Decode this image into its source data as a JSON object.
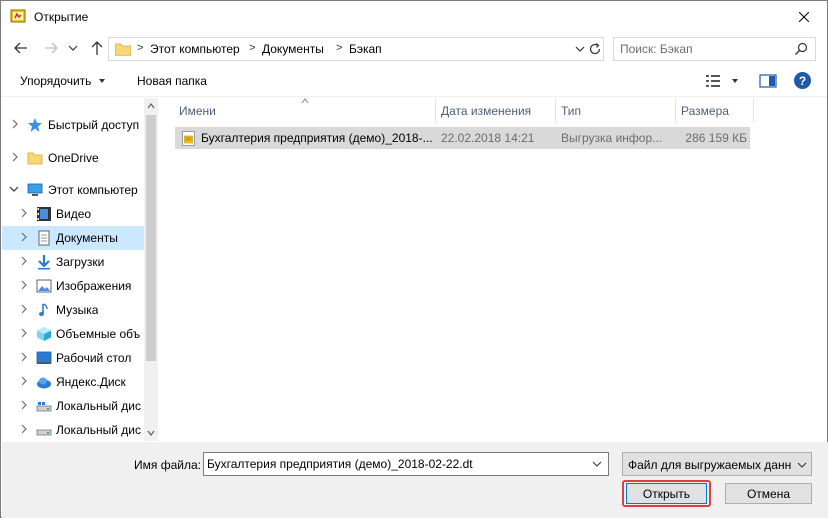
{
  "window": {
    "title": "Открытие"
  },
  "address_bar": {
    "crumbs": [
      "Этот компьютер",
      "Документы",
      "Бэкап"
    ]
  },
  "search": {
    "placeholder": "Поиск: Бэкап"
  },
  "toolbar": {
    "organize_label": "Упорядочить",
    "new_folder_label": "Новая папка"
  },
  "nav_pane": {
    "items": [
      {
        "label": "Быстрый доступ",
        "icon": "star-icon",
        "level": 0,
        "selected": false
      },
      {
        "label": "OneDrive",
        "icon": "folder-icon",
        "level": 0,
        "selected": false
      },
      {
        "label": "Этот компьютер",
        "icon": "computer-icon",
        "level": 0,
        "expanded": true,
        "selected": false
      },
      {
        "label": "Видео",
        "icon": "video-icon",
        "level": 1,
        "selected": false
      },
      {
        "label": "Документы",
        "icon": "documents-icon",
        "level": 1,
        "selected": true
      },
      {
        "label": "Загрузки",
        "icon": "downloads-icon",
        "level": 1,
        "selected": false
      },
      {
        "label": "Изображения",
        "icon": "pictures-icon",
        "level": 1,
        "selected": false
      },
      {
        "label": "Музыка",
        "icon": "music-icon",
        "level": 1,
        "selected": false
      },
      {
        "label": "Объемные объ",
        "icon": "3d-objects-icon",
        "level": 1,
        "selected": false
      },
      {
        "label": "Рабочий стол",
        "icon": "desktop-icon",
        "level": 1,
        "selected": false
      },
      {
        "label": "Яндекс.Диск",
        "icon": "yandex-disk-icon",
        "level": 1,
        "selected": false
      },
      {
        "label": "Локальный дис",
        "icon": "drive-icon",
        "level": 1,
        "selected": false
      },
      {
        "label": "Локальный дис",
        "icon": "drive-icon",
        "level": 1,
        "selected": false
      }
    ]
  },
  "file_list": {
    "columns": [
      "Имени",
      "Дата изменения",
      "Тип",
      "Размера"
    ],
    "rows": [
      {
        "name": "Бухгалтерия предприятия (демо)_2018-...",
        "date": "22.02.2018 14:21",
        "type": "Выгрузка инфор...",
        "size": "286 159 КБ",
        "selected": true
      }
    ]
  },
  "footer": {
    "file_name_label": "Имя файла:",
    "file_name_value": "Бухгалтерия предприятия (демо)_2018-02-22.dt",
    "file_type_filter": "Файл для выгружаемых данны",
    "open_label": "Открыть",
    "cancel_label": "Отмена"
  },
  "colors": {
    "selection": "#cce8ff",
    "selected_row": "#d9d9d9",
    "highlight_outline": "#e0403c",
    "header_text": "#4c607a",
    "accent": "#0078d7"
  }
}
